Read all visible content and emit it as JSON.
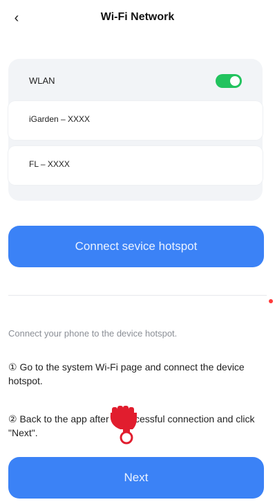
{
  "header": {
    "back_icon": "chevron-left-icon",
    "title": "Wi-Fi Network"
  },
  "wifi": {
    "wlan_label": "WLAN",
    "wlan_enabled": true,
    "toggle_color": "#22c35e",
    "networks": [
      {
        "name": "iGarden – XXXX"
      },
      {
        "name": "FL – XXXX"
      }
    ]
  },
  "buttons": {
    "connect_hotspot": "Connect sevice hotspot",
    "next": "Next",
    "primary_color": "#3b82f6"
  },
  "instructions": {
    "intro": "Connect your phone to the device hotspot.",
    "step1": "① Go to the system Wi-Fi page and connect the device hotspot.",
    "step2": "② Back to the app after a successful connection and click \"Next\"."
  },
  "indicator": {
    "icon": "pointing-hand-icon",
    "accent_color": "#e11d2e"
  }
}
